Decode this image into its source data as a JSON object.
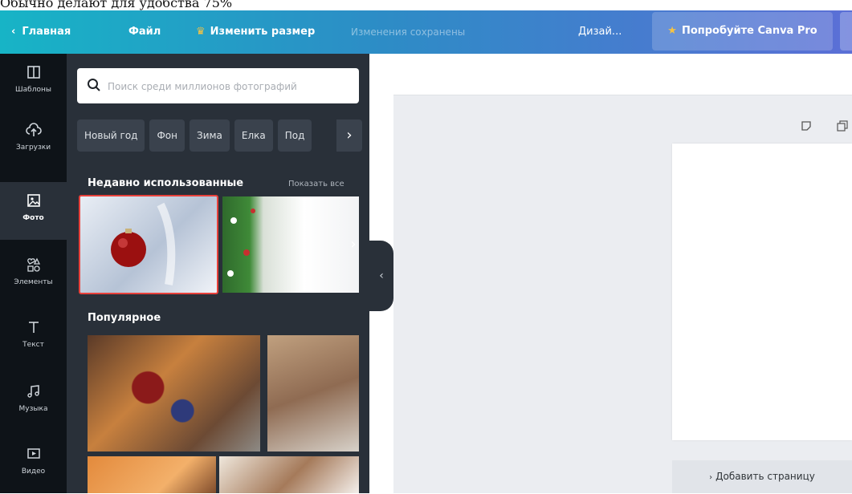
{
  "caption": "Обычно делают для удобства 75%",
  "topbar": {
    "back_label": "Главная",
    "file_label": "Файл",
    "resize_label": "Изменить размер",
    "saved_status": "Изменения сохранены",
    "design_name": "Дизай...",
    "pro_label": "Попробуйте Canva Pro"
  },
  "rail": [
    {
      "label": "Шаблоны",
      "icon": "templates-icon"
    },
    {
      "label": "Загрузки",
      "icon": "upload-icon"
    },
    {
      "label": "Фото",
      "icon": "photo-icon"
    },
    {
      "label": "Элементы",
      "icon": "elements-icon"
    },
    {
      "label": "Текст",
      "icon": "text-icon"
    },
    {
      "label": "Музыка",
      "icon": "music-icon"
    },
    {
      "label": "Видео",
      "icon": "video-icon"
    }
  ],
  "panel": {
    "search_placeholder": "Поиск среди миллионов фотографий",
    "chips": [
      "Новый год",
      "Фон",
      "Зима",
      "Елка",
      "Под"
    ],
    "recent_title": "Недавно использованные",
    "show_all": "Показать все",
    "popular_title": "Популярное"
  },
  "canvas": {
    "add_page": "Добавить страницу"
  },
  "colors": {
    "accent_selected": "#e8413b",
    "panel_bg": "#293039",
    "rail_bg": "#0e1318",
    "topbar_start": "#17b4c6",
    "topbar_end": "#5b6fd6"
  }
}
